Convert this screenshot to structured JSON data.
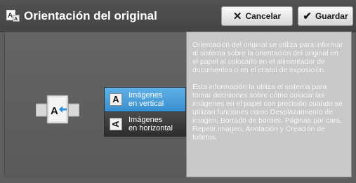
{
  "header": {
    "title": "Orientación del original",
    "title_icon": "document-orientation-icon",
    "cancel_label": "Cancelar",
    "cancel_icon": "close-x-icon",
    "save_label": "Guardar",
    "save_icon": "checkmark-icon"
  },
  "options": {
    "vertical": {
      "line1": "Imágenes",
      "line2": "en vertical",
      "glyph": "A",
      "selected": true
    },
    "horizontal": {
      "line1": "Imágenes",
      "line2": "en horizontal",
      "glyph": "A",
      "selected": false
    }
  },
  "illustration": {
    "label": "A",
    "icon": "document-feeder-illustration-icon"
  },
  "info": {
    "paragraph1": "Orientación del original se utiliza para informar al sistema sobre la orientación del original en el papel al colocarlo en el alimentador de documentos o en el cristal de exposición.",
    "paragraph2": "Esta información la utiliza el sistema para tomar decisiones sobre cómo colocar las imágenes en el papel con precisión cuando se utilizan funciones como Desplazamiento de imagen, Borrado de bordes, Páginas por cara, Repetir imagen, Anotación y Creación de folletos."
  },
  "colors": {
    "selected": "#4aa0dc",
    "unselected": "#3a3a3a",
    "header": "#4a4a4a",
    "info_bg": "#c9c9c9"
  }
}
